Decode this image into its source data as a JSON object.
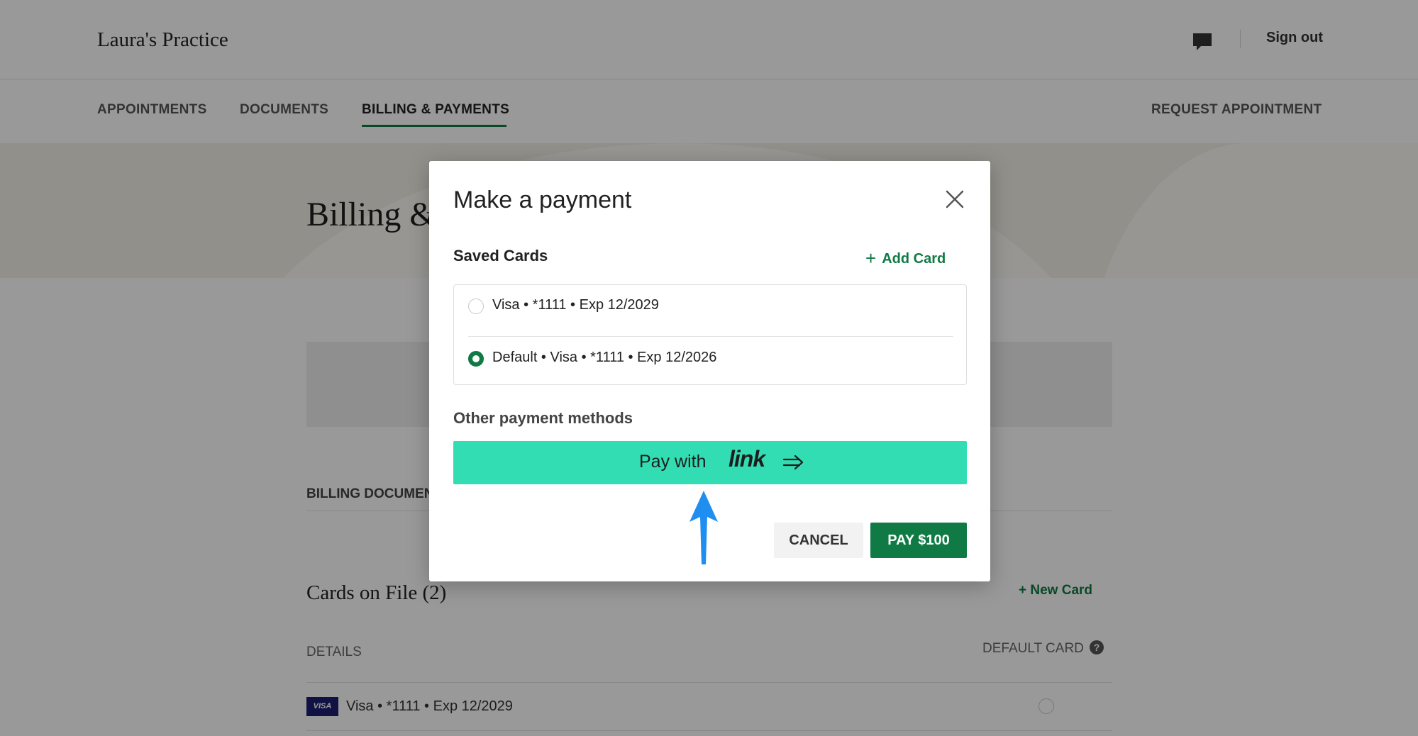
{
  "header": {
    "practice_name": "Laura's Practice",
    "sign_out": "Sign out"
  },
  "nav": {
    "items": [
      {
        "label": "APPOINTMENTS"
      },
      {
        "label": "DOCUMENTS"
      },
      {
        "label": "BILLING & PAYMENTS",
        "active": true
      }
    ],
    "request_appointment": "REQUEST APPOINTMENT"
  },
  "page": {
    "title": "Billing &",
    "billing_documents": "BILLING DOCUMEN",
    "cards_on_file": "Cards on File (2)",
    "new_card": "+ New Card",
    "details_header": "DETAILS",
    "default_card_header": "DEFAULT CARD",
    "card_brand_badge": "VISA",
    "card_rows": [
      {
        "text": "Visa • *1111 • Exp 12/2029"
      }
    ]
  },
  "modal": {
    "title": "Make a payment",
    "saved_cards_label": "Saved Cards",
    "add_card": "Add Card",
    "add_card_icon": "+",
    "saved_cards": [
      {
        "label": "Visa • *1111 • Exp 12/2029",
        "selected": false
      },
      {
        "label": "Default • Visa • *1111 • Exp 12/2026",
        "selected": true
      }
    ],
    "other_methods_label": "Other payment methods",
    "link_button": {
      "prefix": "Pay with",
      "brand": "link"
    },
    "cancel": "CANCEL",
    "pay": "PAY $100"
  },
  "colors": {
    "accent_green": "#0f7a44",
    "link_teal": "#33ddb3",
    "annotation_blue": "#1e8ff0"
  },
  "icons": [
    "message-icon",
    "close-icon",
    "plus-icon",
    "radio-icon",
    "double-arrow-icon",
    "help-icon",
    "visa-icon",
    "up-arrow-icon"
  ]
}
